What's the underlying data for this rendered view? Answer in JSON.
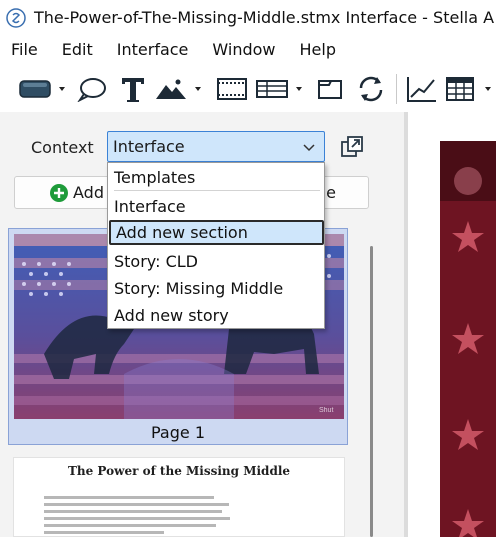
{
  "window": {
    "title": "The-Power-of-The-Missing-Middle.stmx Interface - Stella A"
  },
  "menubar": {
    "items": [
      "File",
      "Edit",
      "Interface",
      "Window",
      "Help"
    ]
  },
  "toolbar": {
    "tools": [
      "stock-tool-icon",
      "comment-tool-icon",
      "text-tool-icon",
      "image-tool-icon",
      "storyboard-tool-icon",
      "input-device-tool-icon",
      "page-tool-icon",
      "loop-tool-icon",
      "graph-tool-icon",
      "table-tool-icon"
    ]
  },
  "context": {
    "label": "Context",
    "selected": "Interface"
  },
  "buttons": {
    "add_label": "Add",
    "page_label": "ge"
  },
  "dropdown": {
    "header": "Templates",
    "options": [
      "Interface",
      "Add new section",
      "Story: CLD",
      "Story: Missing Middle",
      "Add new story"
    ],
    "highlighted": "Add new section"
  },
  "pages": {
    "page1_caption": "Page 1",
    "page2_title": "The Power of the Missing Middle"
  },
  "colors": {
    "select_bg": "#cfe6fb",
    "select_border": "#3b82d6",
    "add_icon": "#1e9b3a",
    "canvas_red": "#6b1420"
  }
}
